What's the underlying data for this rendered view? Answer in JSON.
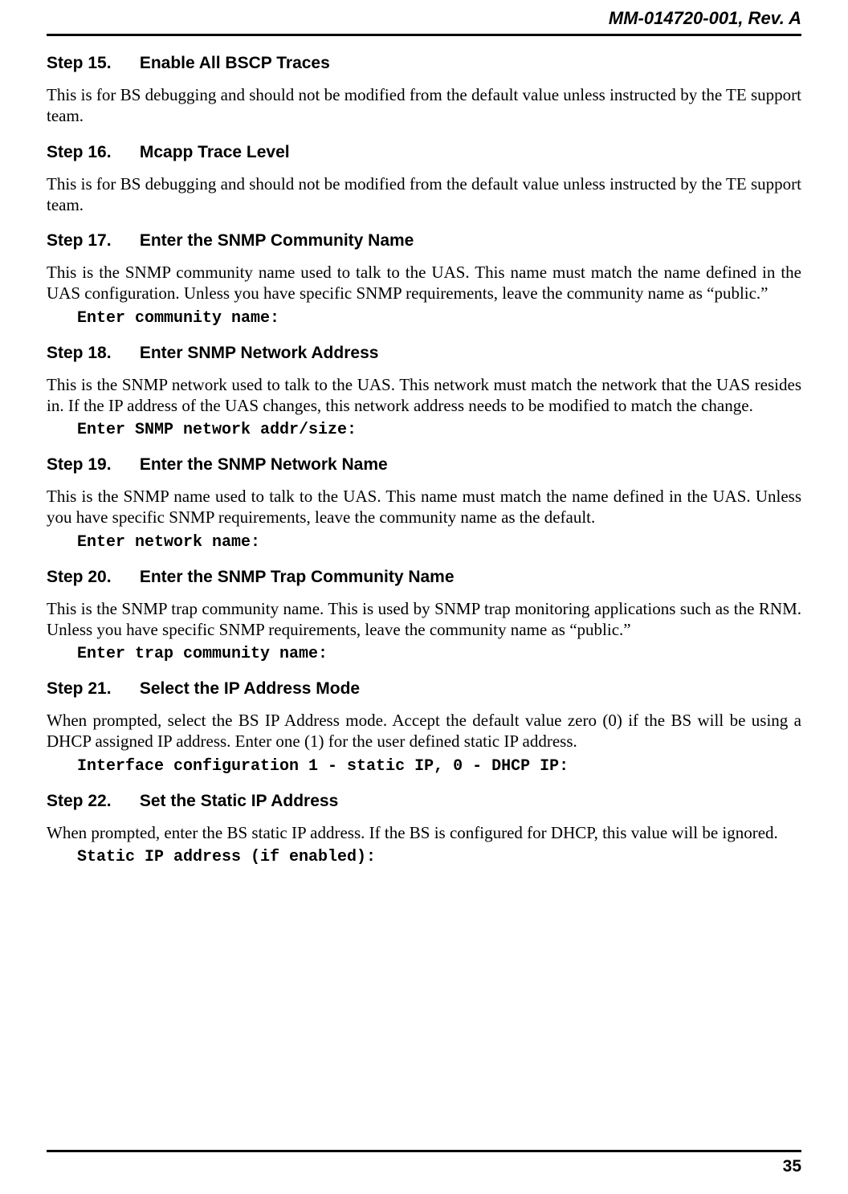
{
  "header": {
    "doc_id": "MM-014720-001, Rev. A"
  },
  "steps": [
    {
      "num": "Step 15.",
      "title": "Enable All BSCP Traces",
      "body": "This is for BS debugging and should not be modified from the default value unless instructed by the TE support team.",
      "code": null
    },
    {
      "num": "Step 16.",
      "title": "Mcapp Trace Level",
      "body": "This is for BS debugging and should not be modified from the default value unless instructed by the TE support team.",
      "code": null
    },
    {
      "num": "Step 17.",
      "title": "Enter the SNMP Community Name",
      "body": "This is the SNMP community name used to talk to the UAS.  This name must match the name defined in the UAS configuration.  Unless you have specific SNMP requirements, leave the community name as “public.”",
      "code": "Enter community name:"
    },
    {
      "num": "Step 18.",
      "title": "Enter SNMP Network Address",
      "body": "This is the SNMP network used to talk to the UAS.  This network must match the network that the UAS resides in.  If the IP address of the UAS changes, this network address needs to be modified to match the change.",
      "code": "Enter SNMP network addr/size:"
    },
    {
      "num": "Step 19.",
      "title": "Enter the SNMP Network Name",
      "body": "This is the SNMP name used to talk to the UAS.  This name must match the name defined in the UAS. Unless you have specific SNMP requirements, leave the community name as the default.",
      "code": "Enter network name:"
    },
    {
      "num": "Step 20.",
      "title": "Enter the SNMP Trap Community Name",
      "body": "This is the SNMP trap community name.  This is used by SNMP trap monitoring applications such as the RNM.  Unless you have specific SNMP requirements, leave the community name as “public.”",
      "code": "Enter trap community name:"
    },
    {
      "num": "Step 21.",
      "title": "Select the IP Address Mode",
      "body": "When prompted, select the BS IP Address mode.  Accept the default value zero (0) if the BS will be using a DHCP assigned IP address.  Enter one (1) for the user defined static IP address.",
      "code": "Interface configuration 1 - static IP, 0 - DHCP IP:"
    },
    {
      "num": "Step 22.",
      "title": "Set the Static IP Address",
      "body": "When prompted, enter the BS static IP address.  If the BS is configured for DHCP, this value will be ignored.",
      "code": "Static IP address (if enabled):"
    }
  ],
  "footer": {
    "page_num": "35"
  }
}
